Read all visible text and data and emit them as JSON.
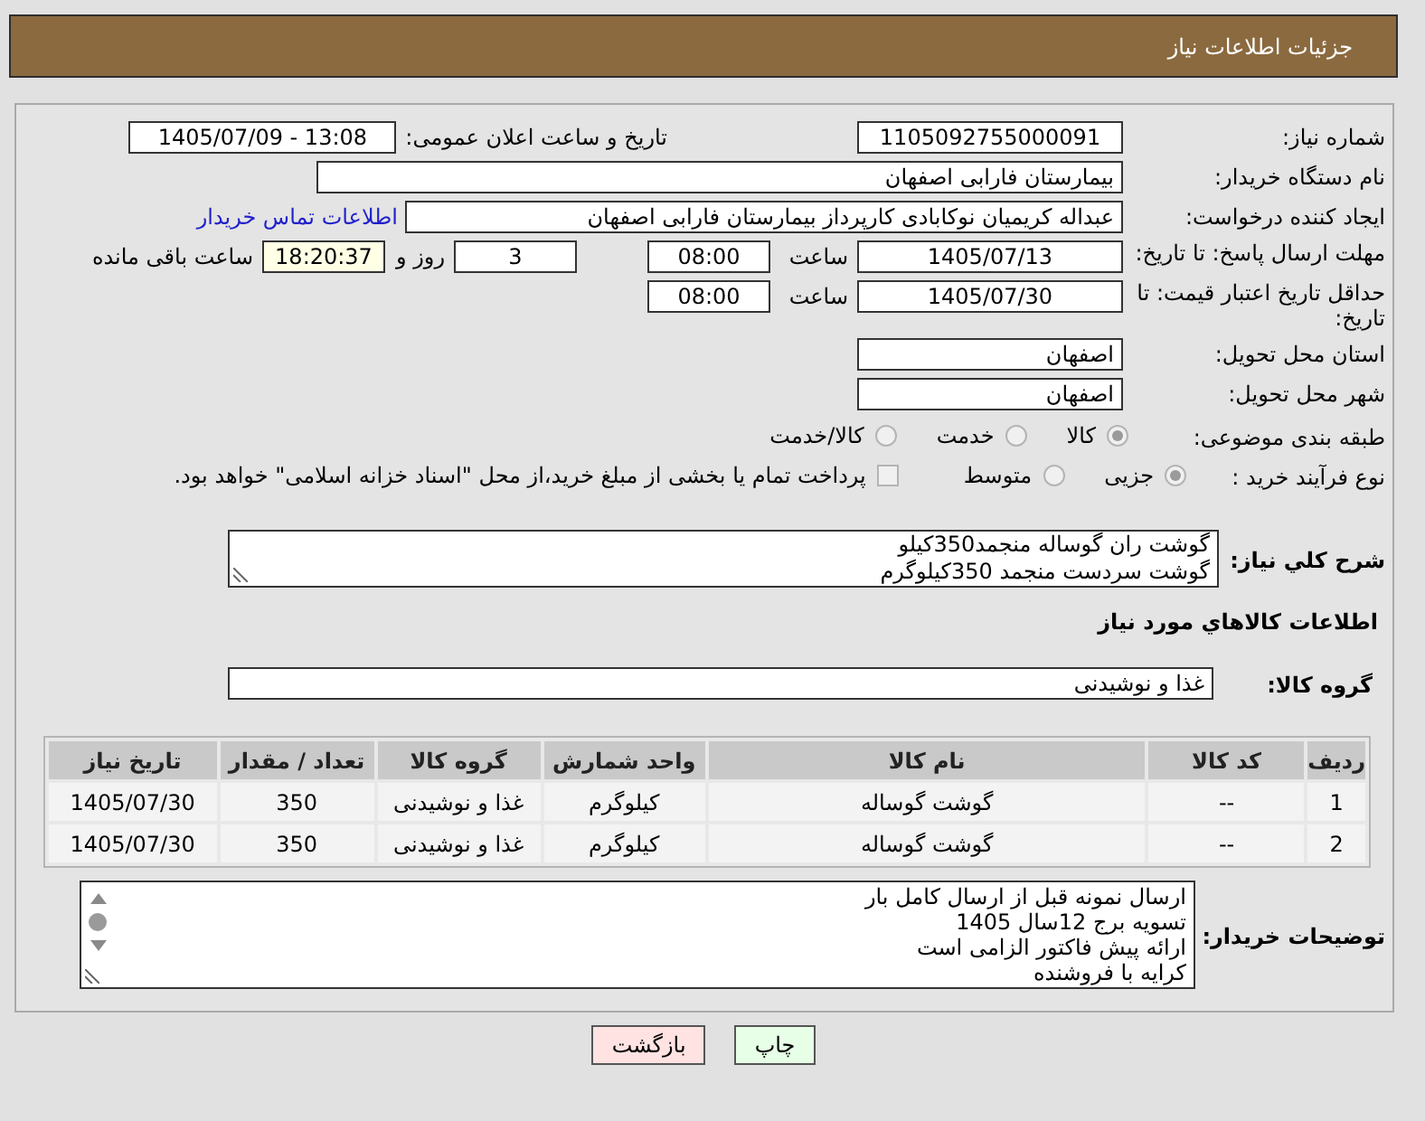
{
  "header": {
    "title": "جزئیات اطلاعات نیاز"
  },
  "need_number": {
    "label": "شماره نیاز:",
    "value": "1105092755000091"
  },
  "announce": {
    "label": "تاریخ و ساعت اعلان عمومی:",
    "value": "1405/07/09 - 13:08"
  },
  "buyer_org": {
    "label": "نام دستگاه خریدار:",
    "value": "بیمارستان فارابی اصفهان"
  },
  "requester": {
    "label": "ایجاد کننده درخواست:",
    "value": "عبداله کریمیان نوکابادی کارپرداز بیمارستان فارابی اصفهان",
    "link": "اطلاعات تماس خریدار"
  },
  "reply_deadline": {
    "label": "مهلت ارسال پاسخ: تا تاریخ:",
    "date": "1405/07/13",
    "time_label": "ساعت",
    "time": "08:00",
    "days": "3",
    "days_label": "روز و",
    "remaining": "18:20:37",
    "remaining_label": "ساعت باقی مانده"
  },
  "price_validity": {
    "label": "حداقل تاریخ اعتبار قیمت: تا تاریخ:",
    "date": "1405/07/30",
    "time_label": "ساعت",
    "time": "08:00"
  },
  "province": {
    "label": "استان محل تحویل:",
    "value": "اصفهان"
  },
  "city": {
    "label": "شهر محل تحویل:",
    "value": "اصفهان"
  },
  "category": {
    "label": "طبقه بندی موضوعی:",
    "options": [
      {
        "label": "کالا",
        "selected": true
      },
      {
        "label": "خدمت",
        "selected": false
      },
      {
        "label": "کالا/خدمت",
        "selected": false
      }
    ]
  },
  "process": {
    "label": "نوع فرآیند خرید :",
    "options": [
      {
        "label": "جزیی",
        "selected": true
      },
      {
        "label": "متوسط",
        "selected": false
      }
    ],
    "treasury": {
      "label": "پرداخت تمام یا بخشی از مبلغ خرید،از محل \"اسناد خزانه اسلامی\" خواهد بود.",
      "checked": false
    }
  },
  "description": {
    "label": "شرح کلي نیاز:",
    "lines": [
      "گوشت ران گوساله منجمد350کیلو",
      "گوشت سردست منجمد 350کیلوگرم"
    ]
  },
  "goods_heading": "اطلاعات کالاهاي مورد نیاز",
  "goods_group": {
    "label": "گروه کالا:",
    "value": "غذا و نوشیدنی"
  },
  "table": {
    "columns": [
      "ردیف",
      "کد کالا",
      "نام کالا",
      "واحد شمارش",
      "گروه کالا",
      "تعداد / مقدار",
      "تاریخ نیاز"
    ],
    "rows": [
      [
        "1",
        "--",
        "گوشت گوساله",
        "کیلوگرم",
        "غذا و نوشیدنی",
        "350",
        "1405/07/30"
      ],
      [
        "2",
        "--",
        "گوشت گوساله",
        "کیلوگرم",
        "غذا و نوشیدنی",
        "350",
        "1405/07/30"
      ]
    ]
  },
  "buyer_notes": {
    "label": "توضیحات خریدار:",
    "lines": [
      "ارسال نمونه قبل از ارسال کامل بار",
      "تسویه برج 12سال 1405",
      "ارائه پیش فاکتور الزامی است",
      "کرایه با فروشنده"
    ]
  },
  "buttons": [
    {
      "kind": "print",
      "label": "چاپ"
    },
    {
      "kind": "back",
      "label": "بازگشت"
    }
  ]
}
